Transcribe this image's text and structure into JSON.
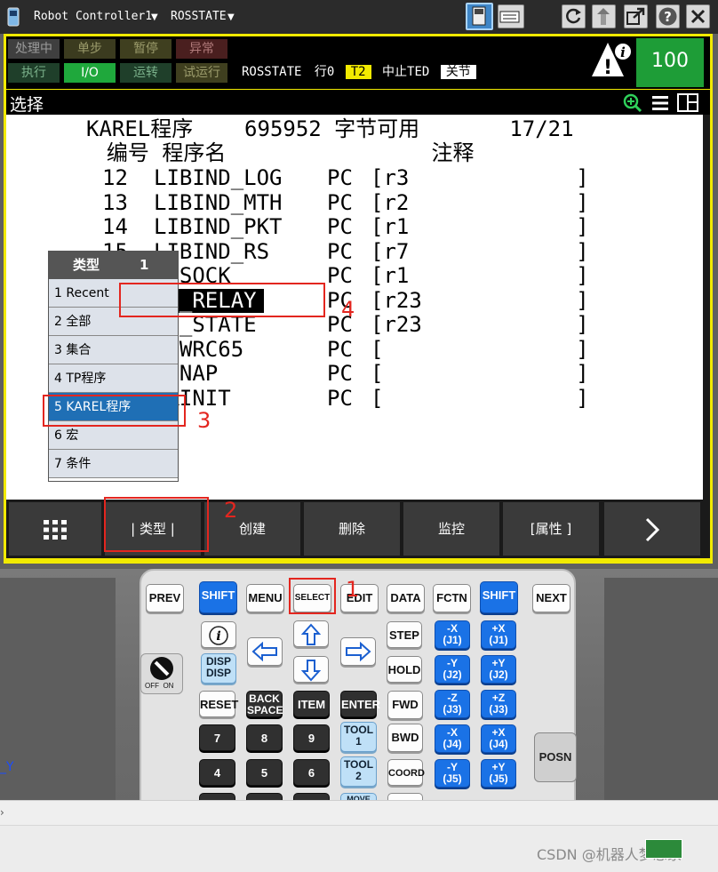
{
  "titlebar": {
    "controller": "Robot Controller1",
    "program": "ROSSTATE"
  },
  "status": {
    "leds": [
      "处理中",
      "单步",
      "暂停",
      "异常",
      "执行",
      "I/O",
      "运转",
      "试运行"
    ],
    "program": "ROSSTATE",
    "line": "行0",
    "mode": "T2",
    "state": "中止TED",
    "joint": "关节",
    "override": "100"
  },
  "menubar": {
    "title": "选择"
  },
  "screen": {
    "header": "KAREL程序    695952 字节可用       17/21",
    "columns": "  编号 程序名                注释",
    "rows": [
      {
        "no": "12",
        "name": "LIBIND_LOG",
        "type": "PC",
        "comment": "[r3             ]"
      },
      {
        "no": "13",
        "name": "LIBIND_MTH",
        "type": "PC",
        "comment": "[r2             ]"
      },
      {
        "no": "14",
        "name": "LIBIND_PKT",
        "type": "PC",
        "comment": "[r1             ]"
      },
      {
        "no": "15",
        "name": "LIBIND_RS",
        "type": "PC",
        "comment": "[r7             ]"
      },
      {
        "no": "",
        "name": "BSSOCK",
        "type": "PC",
        "comment": "[r1             ]"
      },
      {
        "no": "",
        "name": "OS_RELAY",
        "type": "PC",
        "comment": "[r23            ]"
      },
      {
        "no": "",
        "name": "OS_STATE",
        "type": "PC",
        "comment": "[r23            ]"
      },
      {
        "no": "",
        "name": "SSWRC65",
        "type": "PC",
        "comment": "[               ]"
      },
      {
        "no": "",
        "name": "PSNAP",
        "type": "PC",
        "comment": "[               ]"
      },
      {
        "no": "",
        "name": "MRINIT",
        "type": "PC",
        "comment": "[               ]"
      }
    ]
  },
  "popup": {
    "title": "类型",
    "page": "1",
    "items": [
      "1 Recent",
      "2 全部",
      "3 集合",
      "4 TP程序",
      "5 KAREL程序",
      "6 宏",
      "7 条件"
    ]
  },
  "fkeys": [
    "| 类型 |",
    "创建",
    "删除",
    "监控",
    "[属性 ]"
  ],
  "annotations": [
    "1",
    "2",
    "3",
    "4"
  ],
  "pendant": {
    "prev": "PREV",
    "shift": "SHIFT",
    "menu": "MENU",
    "select": "SELECT",
    "edit": "EDIT",
    "data": "DATA",
    "fctn": "FCTN",
    "next": "NEXT",
    "disp": "DISP",
    "step": "STEP",
    "hold": "HOLD",
    "reset": "RESET",
    "back1": "BACK",
    "back2": "SPACE",
    "item": "ITEM",
    "enter": "ENTER",
    "fwd": "FWD",
    "bwd": "BWD",
    "tool": "TOOL",
    "coord": "COORD",
    "move": "MOVE",
    "posn": "POSN",
    "n7": "7",
    "n8": "8",
    "n9": "9",
    "n4": "4",
    "n5": "5",
    "n6": "6",
    "one": "1",
    "two": "2",
    "jog": [
      {
        "neg": "-X",
        "negj": "(J1)",
        "pos": "+X",
        "posj": "(J1)"
      },
      {
        "neg": "-Y",
        "negj": "(J2)",
        "pos": "+Y",
        "posj": "(J2)"
      },
      {
        "neg": "-Z",
        "negj": "(J3)",
        "pos": "+Z",
        "posj": "(J3)"
      },
      {
        "neg": "-X",
        "negj": "(J4)",
        "pos": "+X",
        "posj": "(J4)"
      },
      {
        "neg": "-Y",
        "negj": "(J5)",
        "pos": "+Y",
        "posj": "(J5)"
      }
    ],
    "off": "OFF",
    "on": "ON"
  },
  "axis_label": "_Y",
  "watermark": "CSDN @机器人梦想家",
  "colors": {
    "accent_yellow": "#f2ea00",
    "override_green": "#1e9d37",
    "select_blue": "#1f6fb5",
    "key_blue": "#1a72e6",
    "annotation_red": "#e3261f"
  }
}
